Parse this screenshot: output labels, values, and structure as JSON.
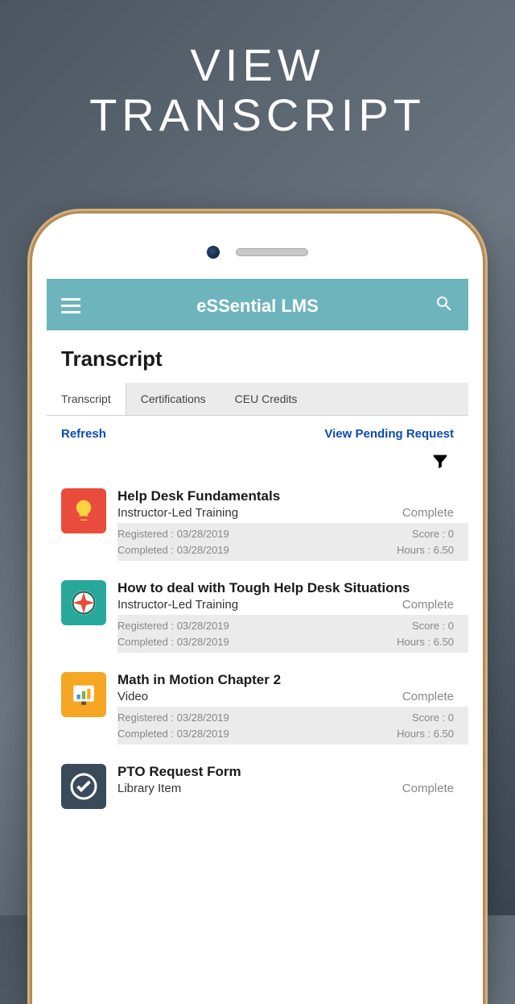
{
  "promo": {
    "line1": "VIEW",
    "line2": "TRANSCRIPT"
  },
  "header": {
    "title": "eSSential LMS"
  },
  "page": {
    "title": "Transcript"
  },
  "tabs": [
    {
      "label": "Transcript",
      "active": true
    },
    {
      "label": "Certifications",
      "active": false
    },
    {
      "label": "CEU Credits",
      "active": false
    }
  ],
  "actions": {
    "refresh": "Refresh",
    "pending": "View Pending Request"
  },
  "courses": [
    {
      "icon": "bulb",
      "title": "Help Desk Fundamentals",
      "type": "Instructor-Led Training",
      "status": "Complete",
      "registered": "Registered : 03/28/2019",
      "completed": "Completed : 03/28/2019",
      "score": "Score : 0",
      "hours": "Hours : 6.50"
    },
    {
      "icon": "compass",
      "title": "How to deal with Tough Help Desk Situations",
      "type": "Instructor-Led Training",
      "status": "Complete",
      "registered": "Registered : 03/28/2019",
      "completed": "Completed : 03/28/2019",
      "score": "Score : 0",
      "hours": "Hours : 6.50"
    },
    {
      "icon": "chart",
      "title": "Math in Motion Chapter 2",
      "type": "Video",
      "status": "Complete",
      "registered": "Registered : 03/28/2019",
      "completed": "Completed : 03/28/2019",
      "score": "Score : 0",
      "hours": "Hours : 6.50"
    },
    {
      "icon": "check",
      "title": "PTO Request Form",
      "type": "Library Item",
      "status": "Complete",
      "registered": "",
      "completed": "",
      "score": "",
      "hours": ""
    }
  ]
}
